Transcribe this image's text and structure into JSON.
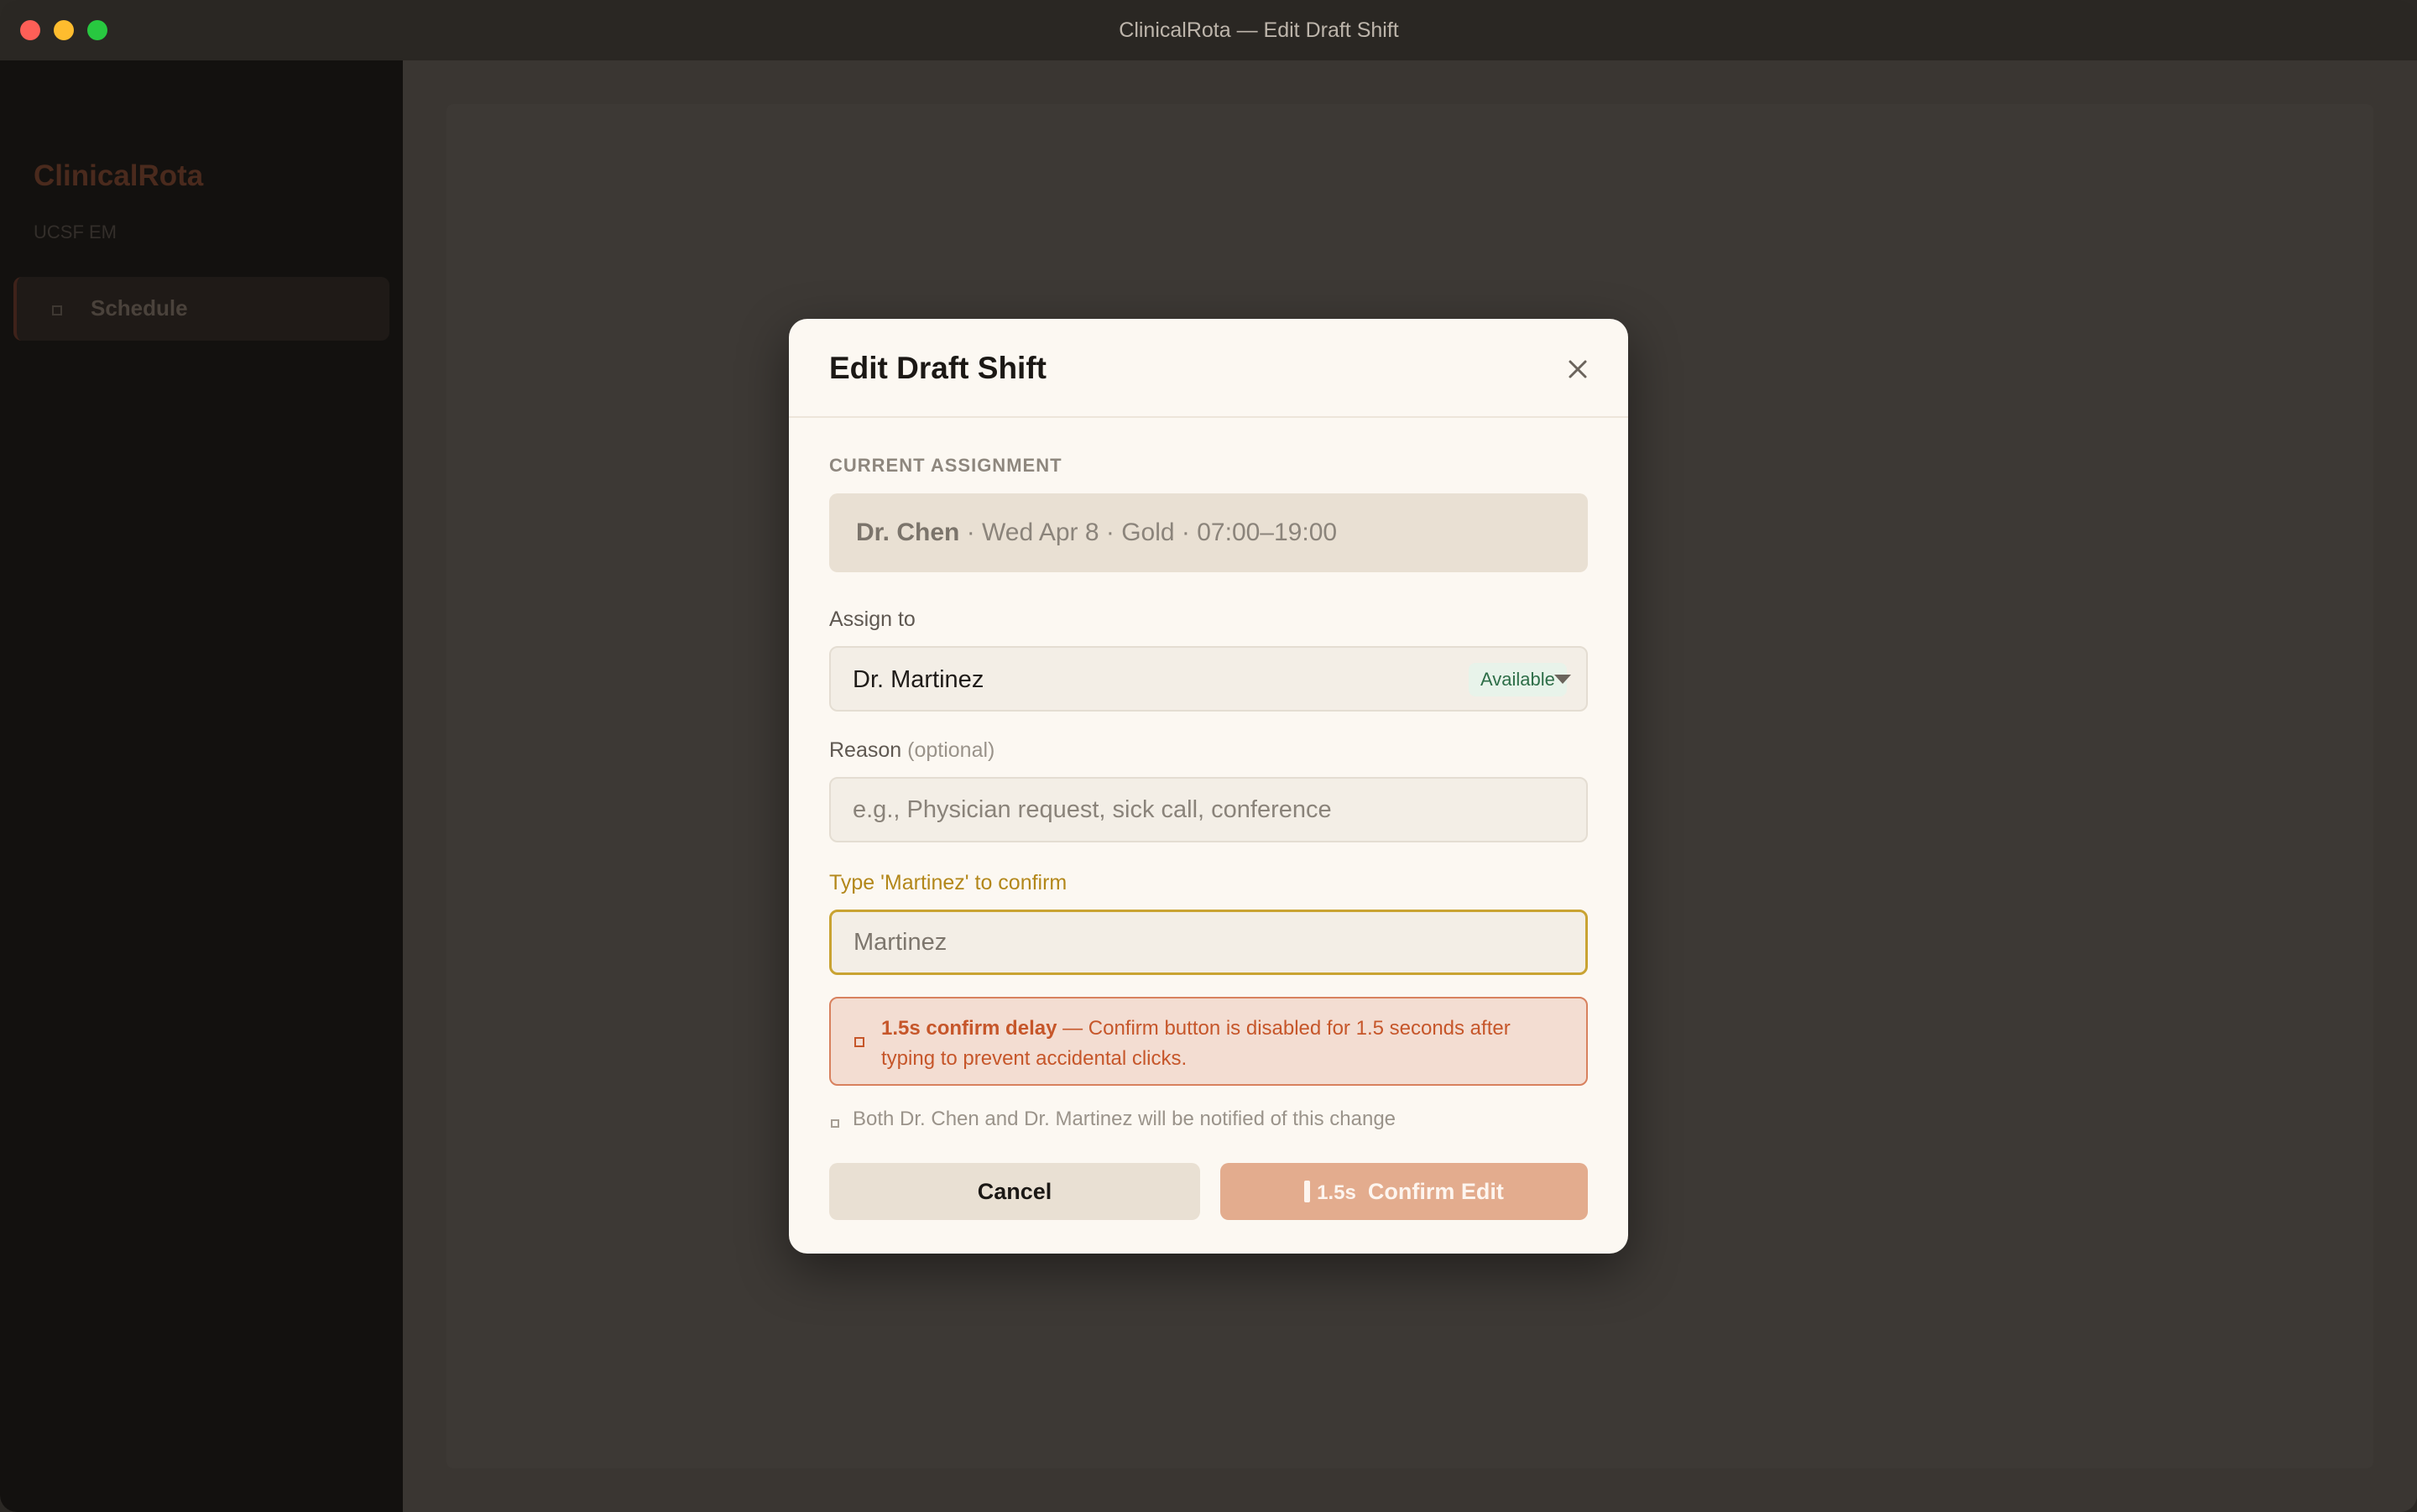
{
  "window": {
    "title": "ClinicalRota — Edit Draft Shift"
  },
  "sidebar": {
    "brand": "ClinicalRota",
    "org": "UCSF EM",
    "items": [
      {
        "label": "Schedule",
        "icon": "calendar-icon"
      }
    ]
  },
  "modal": {
    "title": "Edit Draft Shift",
    "current_section_label": "CURRENT ASSIGNMENT",
    "current": {
      "physician": "Dr. Chen",
      "details": " · Wed Apr 8 · Gold · 07:00–19:00"
    },
    "assign_label": "Assign to",
    "assign_value": "Dr. Martinez",
    "assign_badge": "Available",
    "reason_label": "Reason",
    "reason_optional": "(optional)",
    "reason_placeholder": "e.g., Physician request, sick call, conference",
    "confirm_label": "Type 'Martinez' to confirm",
    "confirm_value": "Martinez",
    "warning_title": "1.5s confirm delay",
    "warning_text": " — Confirm button is disabled for 1.5 seconds after typing to prevent accidental clicks.",
    "notify_text": "Both Dr. Chen and Dr. Martinez will be notified of this change",
    "cancel_label": "Cancel",
    "confirm_timer": "1.5s",
    "confirm_button_label": "Confirm Edit"
  },
  "colors": {
    "accent": "#e3ac8e",
    "warning": "#c6562a",
    "available": "#2e6e48",
    "confirm_border": "#c9a332"
  }
}
